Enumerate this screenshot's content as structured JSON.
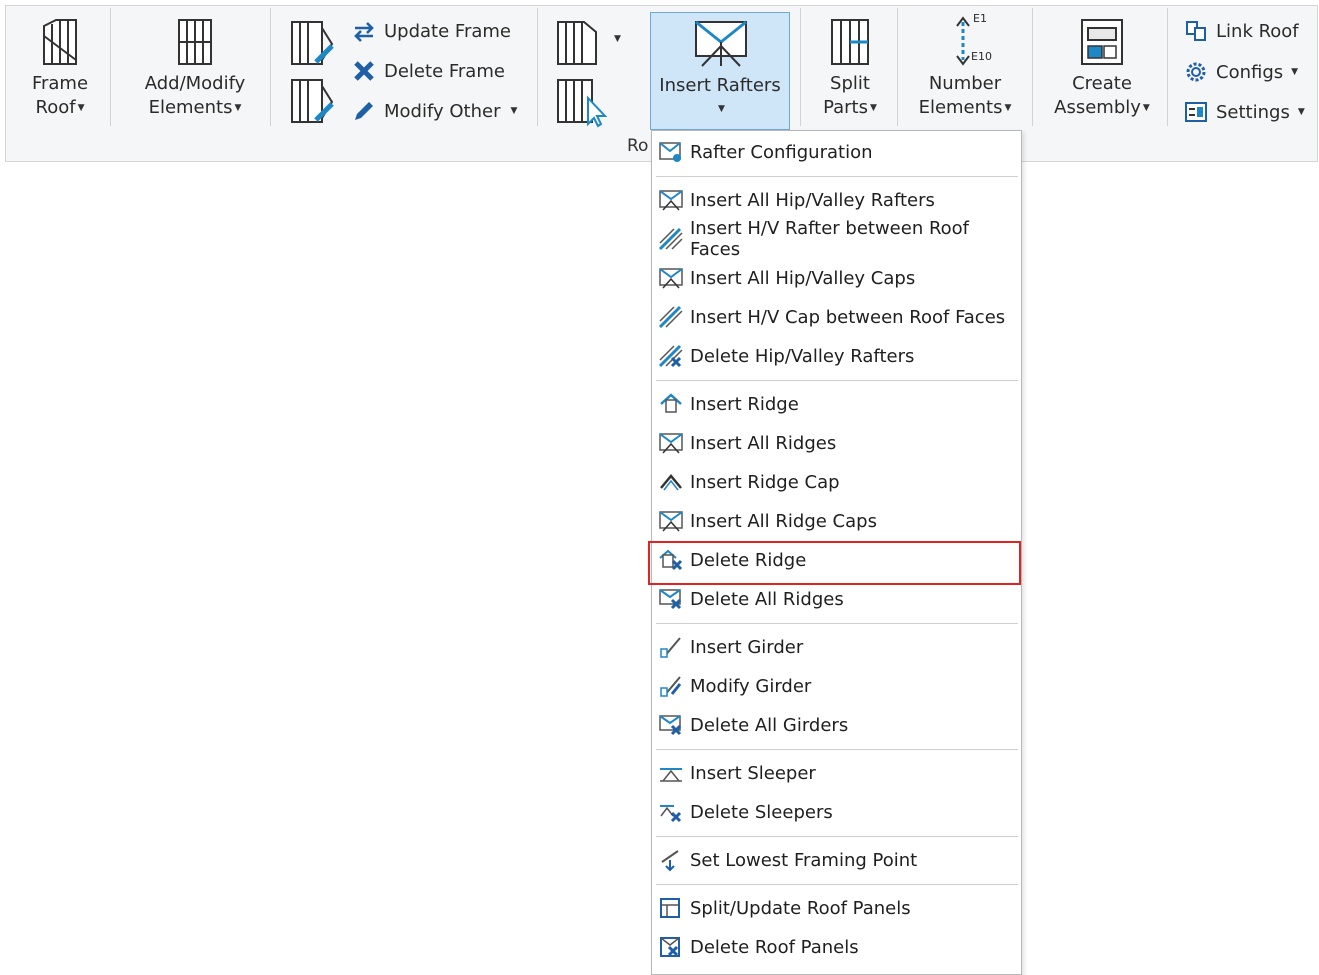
{
  "ribbon": {
    "frame_roof": {
      "line1": "Frame",
      "line2": "Roof"
    },
    "add_modify": {
      "line1": "Add/Modify",
      "line2": "Elements"
    },
    "update_frame": "Update Frame",
    "delete_frame": "Delete Frame",
    "modify_other": "Modify Other",
    "insert_rafters": "Insert Rafters",
    "panel_label": "Ro",
    "split_parts": {
      "line1": "Split",
      "line2": "Parts"
    },
    "number_elements": {
      "line1": "Number",
      "line2": "Elements",
      "tag_top": "E1",
      "tag_bottom": "E10"
    },
    "create_assembly": {
      "line1": "Create",
      "line2": "Assembly"
    },
    "link_roof": "Link Roof",
    "configs": "Configs",
    "settings": "Settings"
  },
  "menu": {
    "items": [
      {
        "label": "Rafter Configuration",
        "icon": "rafter-config-icon"
      },
      {
        "label": "Insert All Hip/Valley Rafters",
        "icon": "hip-valley-rafters-icon"
      },
      {
        "label": "Insert H/V Rafter between Roof Faces",
        "icon": "hv-rafter-faces-icon"
      },
      {
        "label": "Insert All Hip/Valley Caps",
        "icon": "hip-valley-caps-icon"
      },
      {
        "label": "Insert H/V Cap between Roof Faces",
        "icon": "hv-cap-faces-icon"
      },
      {
        "label": "Delete Hip/Valley Rafters",
        "icon": "delete-hip-valley-icon"
      },
      {
        "label": "Insert Ridge",
        "icon": "insert-ridge-icon"
      },
      {
        "label": "Insert All Ridges",
        "icon": "insert-all-ridges-icon"
      },
      {
        "label": "Insert Ridge Cap",
        "icon": "ridge-cap-icon"
      },
      {
        "label": "Insert All Ridge Caps",
        "icon": "all-ridge-caps-icon"
      },
      {
        "label": "Delete Ridge",
        "icon": "delete-ridge-icon"
      },
      {
        "label": "Delete All Ridges",
        "icon": "delete-all-ridges-icon"
      },
      {
        "label": "Insert Girder",
        "icon": "insert-girder-icon"
      },
      {
        "label": "Modify Girder",
        "icon": "modify-girder-icon"
      },
      {
        "label": "Delete All Girders",
        "icon": "delete-girders-icon"
      },
      {
        "label": "Insert Sleeper",
        "icon": "insert-sleeper-icon"
      },
      {
        "label": "Delete Sleepers",
        "icon": "delete-sleepers-icon"
      },
      {
        "label": "Set Lowest Framing Point",
        "icon": "lowest-point-icon"
      },
      {
        "label": "Split/Update Roof Panels",
        "icon": "split-panels-icon"
      },
      {
        "label": "Delete Roof Panels",
        "icon": "delete-panels-icon"
      }
    ]
  },
  "colors": {
    "accent": "#1e88c7",
    "highlight_border": "#e32222",
    "active_bg": "#cfe5f8"
  }
}
